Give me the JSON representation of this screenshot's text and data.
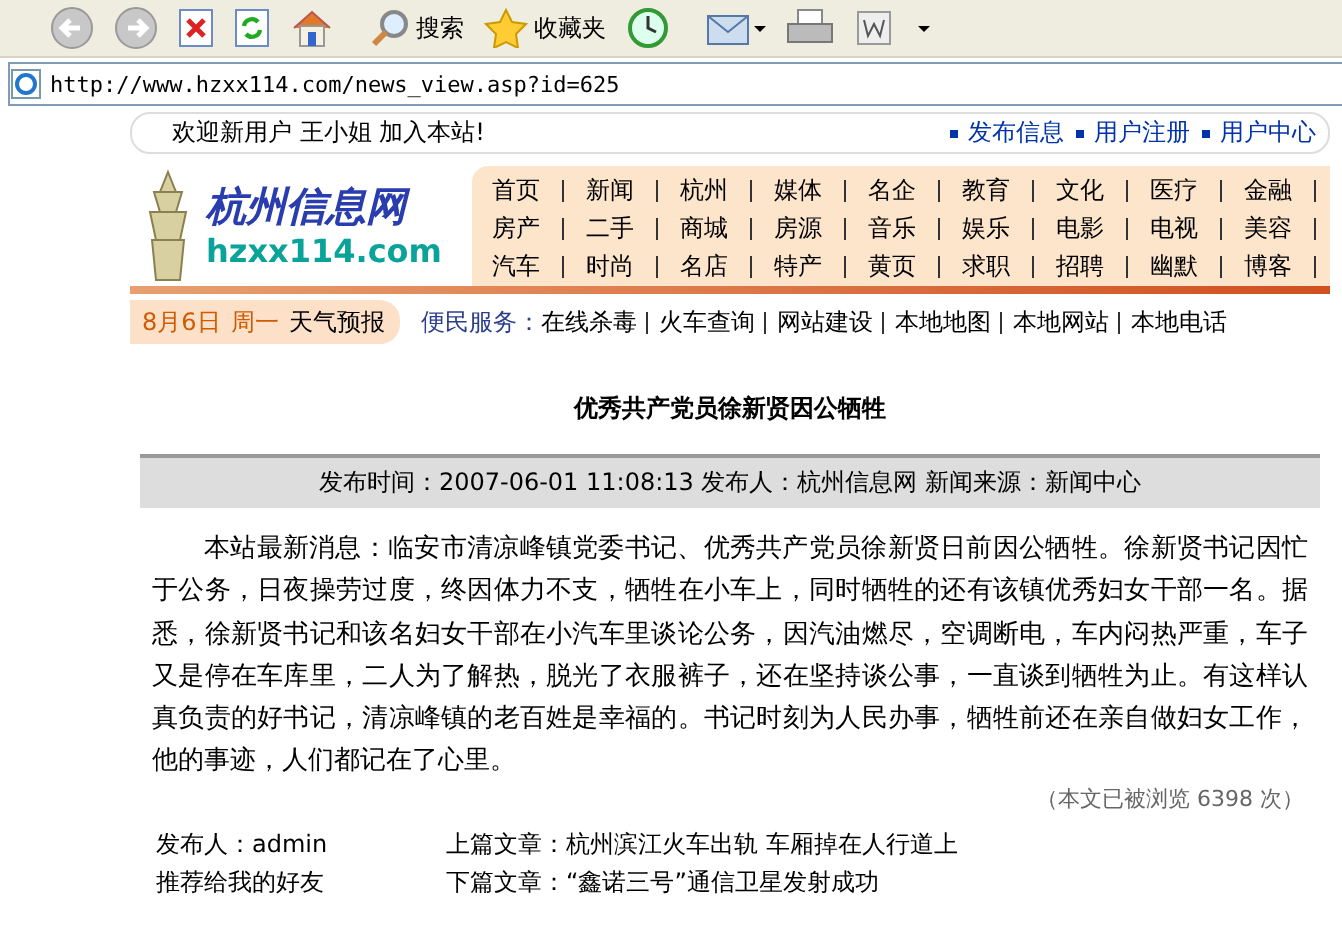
{
  "toolbar": {
    "buttons": [
      {
        "kind": "back"
      },
      {
        "kind": "forward"
      },
      {
        "kind": "stop"
      },
      {
        "kind": "refresh"
      },
      {
        "kind": "home"
      },
      {
        "kind": "search",
        "label": "搜索"
      },
      {
        "kind": "favorites",
        "label": "收藏夹"
      },
      {
        "kind": "history"
      },
      {
        "kind": "mail"
      },
      {
        "kind": "print"
      },
      {
        "kind": "word"
      }
    ]
  },
  "address_bar": {
    "url": "http://www.hzxx114.com/news_view.asp?id=625"
  },
  "welcome_bar": {
    "greeting": "欢迎新用户 王小姐 加入本站!",
    "links": [
      "发布信息",
      "用户注册",
      "用户中心"
    ]
  },
  "logo": {
    "name": "杭州信息网",
    "domain": "hzxx114.com"
  },
  "nav_rows": [
    [
      "首页",
      "新闻",
      "杭州",
      "媒体",
      "名企",
      "教育",
      "文化",
      "医疗",
      "金融"
    ],
    [
      "房产",
      "二手",
      "商城",
      "房源",
      "音乐",
      "娱乐",
      "电影",
      "电视",
      "美容"
    ],
    [
      "汽车",
      "时尚",
      "名店",
      "特产",
      "黄页",
      "求职",
      "招聘",
      "幽默",
      "博客"
    ]
  ],
  "info_bar": {
    "date": "8月6日",
    "weekday": "周一",
    "weather": "天气预报",
    "services_label": "便民服务：",
    "services": [
      "在线杀毒",
      "火车查询",
      "网站建设",
      "本地地图",
      "本地网站",
      "本地电话"
    ]
  },
  "article": {
    "title": "优秀共产党员徐新贤因公牺牲",
    "meta": "发布时间：2007-06-01 11:08:13 发布人：杭州信息网 新闻来源：新闻中心",
    "body": "本站最新消息：临安市清凉峰镇党委书记、优秀共产党员徐新贤日前因公牺牲。徐新贤书记因忙于公务，日夜操劳过度，终因体力不支，牺牲在小车上，同时牺牲的还有该镇优秀妇女干部一名。据悉，徐新贤书记和该名妇女干部在小汽车里谈论公务，因汽油燃尽，空调断电，车内闷热严重，车子又是停在车库里，二人为了解热，脱光了衣服裤子，还在坚持谈公事，一直谈到牺牲为止。有这样认真负责的好书记，清凉峰镇的老百姓是幸福的。书记时刻为人民办事，牺牲前还在亲自做妇女工作，他的事迹，人们都记在了心里。",
    "views": "（本文已被浏览 6398 次）"
  },
  "footer": {
    "publisher": "发布人：admin",
    "recommend": "推荐给我的好友",
    "prev": "上篇文章：杭州滨江火车出轨 车厢掉在人行道上",
    "next": "下篇文章：“鑫诺三号”通信卫星发射成功"
  }
}
